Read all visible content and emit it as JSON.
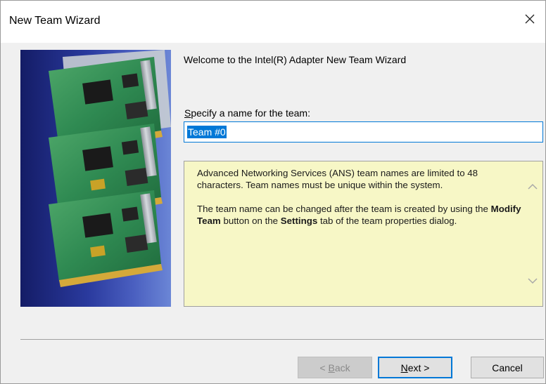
{
  "window": {
    "title": "New Team Wizard",
    "close_icon": "close-icon"
  },
  "welcome": "Welcome to the Intel(R) Adapter New Team Wizard",
  "name_field": {
    "label_accel": "S",
    "label_rest": "pecify a name for the team:",
    "value": "Team #0"
  },
  "info": {
    "para1": "Advanced Networking Services (ANS) team names are limited to 48 characters. Team names must be unique within the system.",
    "para2_part1": "The team name can be changed after the team is created by using the ",
    "para2_bold1": "Modify Team",
    "para2_part2": " button on the ",
    "para2_bold2": "Settings",
    "para2_part3": " tab of the team properties dialog."
  },
  "buttons": {
    "back_prefix": "< ",
    "back_accel": "B",
    "back_rest": "ack",
    "next_accel": "N",
    "next_rest": "ext >",
    "cancel": "Cancel"
  },
  "colors": {
    "accent": "#0078d7",
    "info_bg": "#f7f7c6",
    "art_blue": "#2a3a9e",
    "pcb_green": "#2e8b57"
  }
}
